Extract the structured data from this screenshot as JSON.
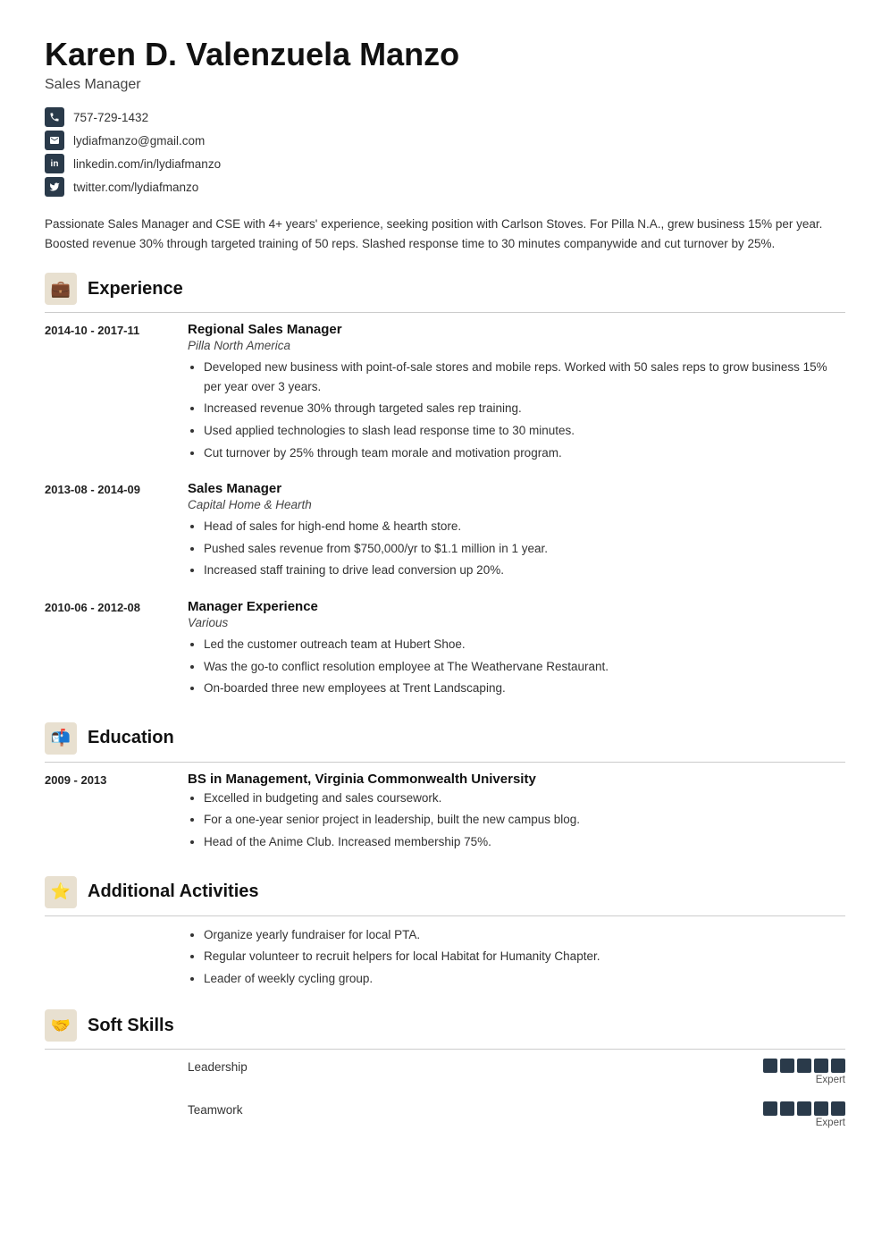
{
  "header": {
    "name": "Karen D. Valenzuela Manzo",
    "job_title": "Sales Manager",
    "contact": [
      {
        "icon": "phone",
        "value": "757-729-1432"
      },
      {
        "icon": "email",
        "value": "lydiafmanzo@gmail.com"
      },
      {
        "icon": "linkedin",
        "value": "linkedin.com/in/lydiafmanzo"
      },
      {
        "icon": "twitter",
        "value": "twitter.com/lydiafmanzo"
      }
    ]
  },
  "summary": "Passionate Sales Manager and CSE with 4+ years' experience, seeking position with Carlson Stoves. For Pilla N.A., grew business 15% per year. Boosted revenue 30% through targeted training of 50 reps. Slashed response time to 30 minutes companywide and cut turnover by 25%.",
  "sections": {
    "experience": {
      "title": "Experience",
      "entries": [
        {
          "date": "2014-10 - 2017-11",
          "role": "Regional Sales Manager",
          "org": "Pilla North America",
          "bullets": [
            "Developed new business with point-of-sale stores and mobile reps. Worked with 50 sales reps to grow business 15% per year over 3 years.",
            "Increased revenue 30% through targeted sales rep training.",
            "Used applied technologies to slash lead response time to 30 minutes.",
            "Cut turnover by 25% through team morale and motivation program."
          ]
        },
        {
          "date": "2013-08 - 2014-09",
          "role": "Sales Manager",
          "org": "Capital Home & Hearth",
          "bullets": [
            "Head of sales for high-end home & hearth store.",
            "Pushed sales revenue from $750,000/yr to $1.1 million in 1 year.",
            "Increased staff training to drive lead conversion up 20%."
          ]
        },
        {
          "date": "2010-06 - 2012-08",
          "role": "Manager Experience",
          "org": "Various",
          "bullets": [
            "Led the customer outreach team at Hubert Shoe.",
            "Was the go-to conflict resolution employee at The Weathervane Restaurant.",
            "On-boarded three new employees at Trent Landscaping."
          ]
        }
      ]
    },
    "education": {
      "title": "Education",
      "entries": [
        {
          "date": "2009 - 2013",
          "role": "BS in Management, Virginia Commonwealth University",
          "org": "",
          "bullets": [
            "Excelled in budgeting and sales coursework.",
            "For a one-year senior project in leadership, built the new campus blog.",
            "Head of the Anime Club. Increased membership 75%."
          ]
        }
      ]
    },
    "activities": {
      "title": "Additional Activities",
      "bullets": [
        "Organize yearly fundraiser for local PTA.",
        "Regular volunteer to recruit helpers for local Habitat for Humanity Chapter.",
        "Leader of weekly cycling group."
      ]
    },
    "skills": {
      "title": "Soft Skills",
      "items": [
        {
          "name": "Leadership",
          "dots": 5,
          "level": "Expert"
        },
        {
          "name": "Teamwork",
          "dots": 5,
          "level": "Expert"
        }
      ]
    }
  }
}
